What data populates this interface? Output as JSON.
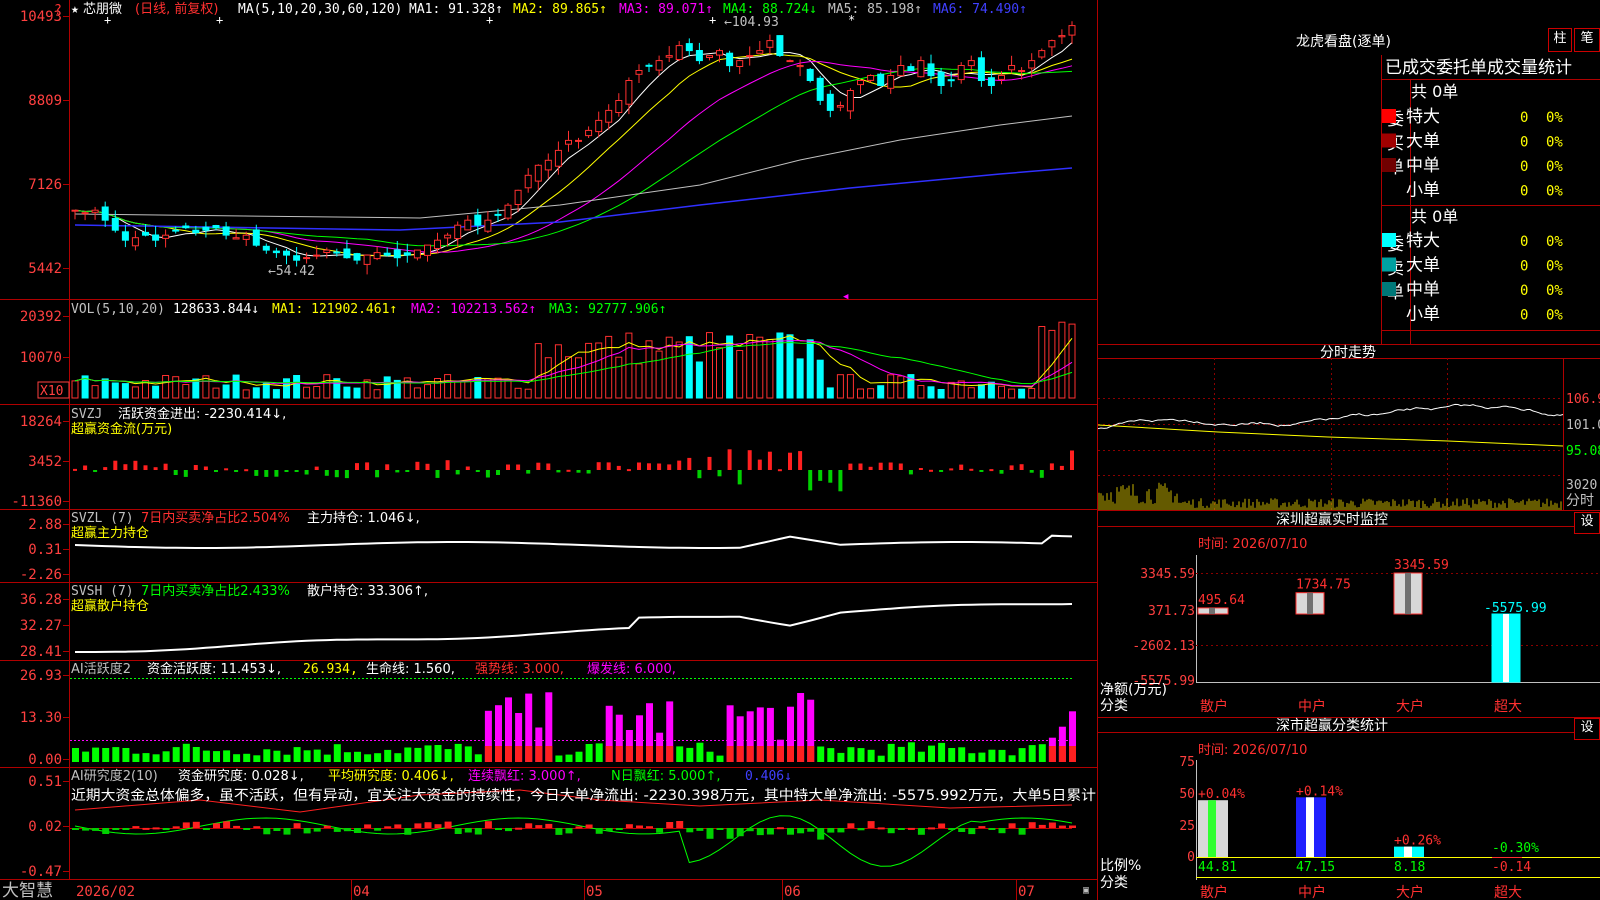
{
  "app": {
    "brand": "大智慧"
  },
  "main_chart": {
    "stock_title": "芯朋微",
    "period": "(日线, 前复权)",
    "ma_params": "MA(5,10,20,30,60,120)",
    "ma1": "MA1: 91.328↑",
    "ma2": "MA2: 89.865↑",
    "ma3": "MA3: 89.071↑",
    "ma4": "MA4: 88.724↓",
    "ma5": "MA5: 85.198↑",
    "ma6": "MA6: 74.490↑",
    "y_ticks": [
      "10493",
      "8809",
      "7126",
      "5442"
    ],
    "high_label": "104.93",
    "low_label": "54.42",
    "colors": {
      "ma1": "#ffffff",
      "ma2": "#ffff00",
      "ma3": "#ff00ff",
      "ma4": "#00ff00",
      "ma5": "#c0c0c0",
      "ma6": "#4040ff",
      "up": "#ff3030",
      "down": "#00ffff"
    }
  },
  "volume": {
    "label": "VOL(5,10,20)",
    "value": "128633.844↓",
    "ma1": "MA1: 121902.461↑",
    "ma2": "MA2: 102213.562↑",
    "ma3": "MA3: 92777.906↑",
    "y_ticks": [
      "20392",
      "10070"
    ],
    "unit": "X10"
  },
  "svzj": {
    "label": "SVZJ",
    "line1": "活跃资金进出: -2230.414↓,",
    "line2": "超赢资金流(万元)",
    "y_ticks": [
      "18264",
      "3452",
      "-11360"
    ]
  },
  "svzl": {
    "label": "SVZL (7)",
    "ratio": "7日内买卖净占比2.504%",
    "hold": "主力持仓: 1.046↓,",
    "line2": "超赢主力持仓",
    "y_ticks": [
      "2.88",
      "0.31",
      "-2.26"
    ]
  },
  "svsh": {
    "label": "SVSH (7)",
    "ratio": "7日内买卖净占比2.433%",
    "hold": "散户持仓: 33.306↑,",
    "line2": "超赢散户持仓",
    "y_ticks": [
      "36.28",
      "32.27",
      "28.41"
    ]
  },
  "ai_active": {
    "label": "AI活跃度2",
    "v1": "资金活跃度: 11.453↓,",
    "v2": "26.934,",
    "v3": "生命线: 1.560,",
    "v4": "强势线: 3.000,",
    "v5": "爆发线: 6.000,",
    "y_ticks": [
      "26.93",
      "13.30",
      "0.00"
    ]
  },
  "ai_research": {
    "label": "AI研究度2(10)",
    "v1": "资金研究度: 0.028↓,",
    "v2": "平均研究度: 0.406↓,",
    "v3": "连续飘红: 3.000↑,",
    "v4": "N日飘红: 5.000↑,",
    "v5": "0.406↓",
    "comment": "近期大资金总体偏多，虽不活跃，但有异动，宜关注大资金的持续性，今日大单净流出: -2230.398万元，其中特大单净流出: -5575.992万元，大单5日累计",
    "y_ticks": [
      "0.51",
      "0.02",
      "-0.47"
    ]
  },
  "x_axis": [
    "2026/02",
    "04",
    "05",
    "06",
    "07"
  ],
  "right": {
    "lhb_title": "龙虎看盘(逐单)",
    "btn_bar": "柱",
    "btn_pen": "笔",
    "order_tabs": "已成交委托单成交量统计",
    "buy": {
      "side_label": "委买单",
      "total": "共 0单",
      "rows": [
        {
          "name": "特大",
          "count": "0",
          "pct": "0%",
          "color": "#ff0000"
        },
        {
          "name": "大单",
          "count": "0",
          "pct": "0%",
          "color": "#a00000"
        },
        {
          "name": "中单",
          "count": "0",
          "pct": "0%",
          "color": "#700000"
        },
        {
          "name": "小单",
          "count": "0",
          "pct": "0%",
          "color": ""
        }
      ]
    },
    "sell": {
      "side_label": "委卖单",
      "total": "共 0单",
      "rows": [
        {
          "name": "特大",
          "count": "0",
          "pct": "0%",
          "color": "#00ffff"
        },
        {
          "name": "大单",
          "count": "0",
          "pct": "0%",
          "color": "#00a0a0"
        },
        {
          "name": "中单",
          "count": "0",
          "pct": "0%",
          "color": "#007878"
        },
        {
          "name": "小单",
          "count": "0",
          "pct": "0%",
          "color": ""
        }
      ]
    },
    "intraday": {
      "title": "分时走势",
      "y_ticks": [
        "106.9",
        "101.0",
        "95.08",
        "3020"
      ],
      "minute_label": "分时"
    },
    "sz_monitor": {
      "title": "深圳超赢实时监控",
      "btn": "设",
      "time": "时间: 2026/07/10",
      "y_ticks": [
        "3345.59",
        "371.73",
        "-2602.13",
        "-5575.99"
      ],
      "y_axis_label": "净额(万元)",
      "x_axis_label": "分类",
      "categories": [
        "散户",
        "中户",
        "大户",
        "超大"
      ],
      "values": [
        495.64,
        1734.75,
        3345.59,
        -5575.99
      ],
      "value_labels": [
        "495.64",
        "1734.75",
        "3345.59",
        "-5575.99"
      ]
    },
    "sz_stats": {
      "title": "深市超赢分类统计",
      "btn": "设",
      "time": "时间: 2026/07/10",
      "y_ticks": [
        "75",
        "50",
        "25",
        "0"
      ],
      "y_axis_label": "比例%",
      "x_axis_label": "分类",
      "categories": [
        "散户",
        "中户",
        "大户",
        "超大"
      ],
      "values": [
        44.81,
        47.15,
        8.18,
        -0.14
      ],
      "value_labels": [
        "44.81",
        "47.15",
        "8.18",
        "-0.14"
      ],
      "change_labels": [
        "+0.04%",
        "+0.14%",
        "+0.26%",
        "-0.30%"
      ]
    }
  }
}
